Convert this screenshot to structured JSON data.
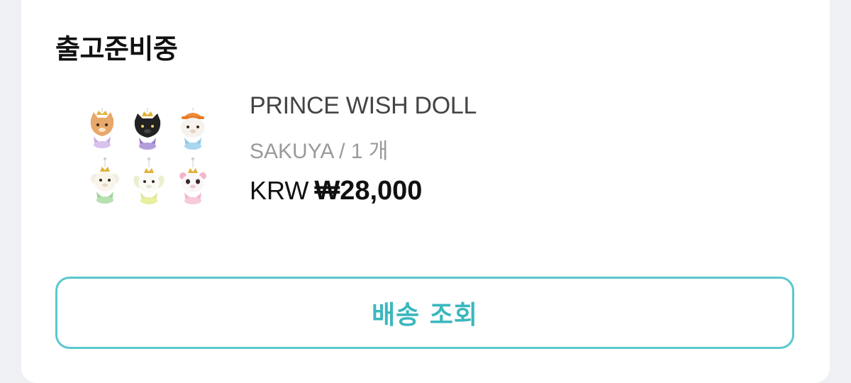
{
  "order": {
    "status": "출고준비중",
    "product": {
      "name": "PRINCE WISH DOLL",
      "option": "SAKUYA / 1 개",
      "currency": "KRW",
      "price": "₩28,000"
    },
    "track_button_label": "배송 조회"
  },
  "colors": {
    "accent": "#3bb7be",
    "accent_border": "#5ac8cf",
    "background": "#eef0f3",
    "card": "#ffffff"
  }
}
